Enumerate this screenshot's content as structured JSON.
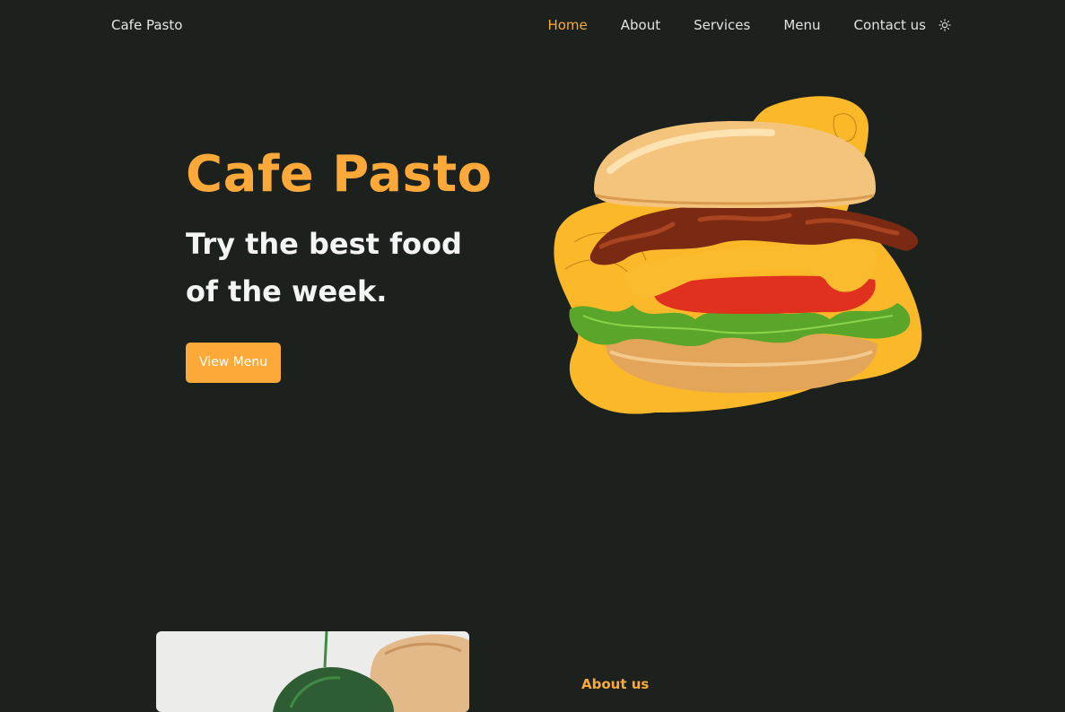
{
  "nav": {
    "brand": "Cafe Pasto",
    "links": [
      {
        "label": "Home",
        "active": true
      },
      {
        "label": "About",
        "active": false
      },
      {
        "label": "Services",
        "active": false
      },
      {
        "label": "Menu",
        "active": false
      },
      {
        "label": "Contact us",
        "active": false
      }
    ],
    "theme_toggle_icon": "sun-icon"
  },
  "hero": {
    "title": "Cafe Pasto",
    "subtitle": "Try the best food of the week.",
    "cta_label": "View Menu",
    "image_icon": "burger-image"
  },
  "about": {
    "label": "About us",
    "image_icon": "salad-image"
  },
  "colors": {
    "background": "#1c211e",
    "accent": "#fca93a",
    "text": "#f4f4f4"
  }
}
